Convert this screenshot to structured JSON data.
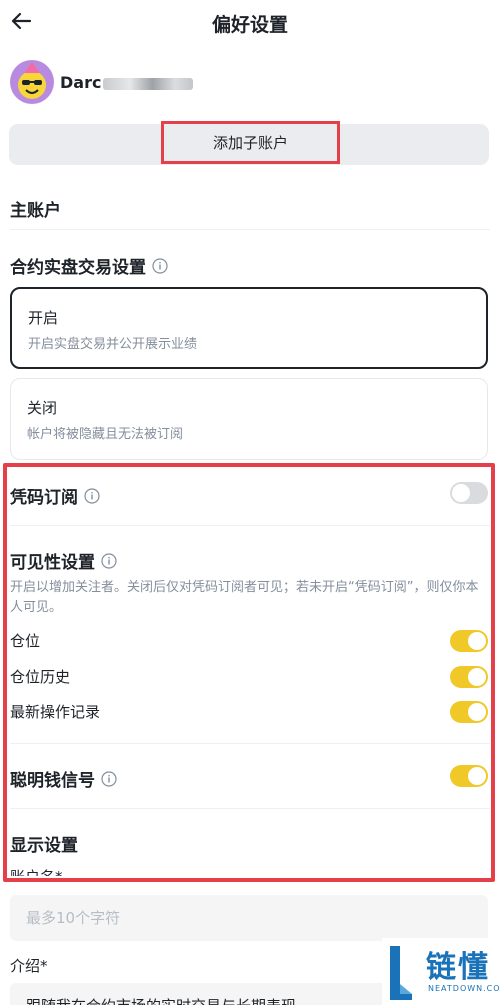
{
  "header": {
    "title": "偏好设置",
    "back_icon": "arrow-left-icon"
  },
  "profile": {
    "username": "Darc"
  },
  "add_sub_account": {
    "label": "添加子账户"
  },
  "main_account": {
    "title": "主账户"
  },
  "contract_trading": {
    "title": "合约实盘交易设置",
    "options": [
      {
        "title": "开启",
        "desc": "开启实盘交易并公开展示业绩",
        "selected": true
      },
      {
        "title": "关闭",
        "desc": "帐户将被隐藏且无法被订阅",
        "selected": false
      }
    ]
  },
  "copy_subscription": {
    "title": "凭码订阅",
    "enabled": false
  },
  "visibility": {
    "title": "可见性设置",
    "desc": "开启以增加关注者。关闭后仅对凭码订阅者可见；若未开启“凭码订阅”，则仅你本人可见。",
    "items": [
      {
        "label": "仓位",
        "enabled": true
      },
      {
        "label": "仓位历史",
        "enabled": true
      },
      {
        "label": "最新操作记录",
        "enabled": true
      }
    ]
  },
  "smart_money": {
    "title": "聪明钱信号",
    "enabled": true
  },
  "display": {
    "title": "显示设置",
    "account_name_label": "账户名*",
    "account_name_placeholder": "最多10个字符",
    "intro_label": "介绍*",
    "intro_value": "跟随我在合约市场的实时交易与长期表现"
  },
  "watermark": {
    "text": "链懂",
    "sub": "NEATDOWN.COM"
  },
  "colors": {
    "accent_red": "#e5404a",
    "toggle_on": "#f0c929",
    "toggle_off": "#d9dbde",
    "watermark_blue": "#1a73b8"
  }
}
